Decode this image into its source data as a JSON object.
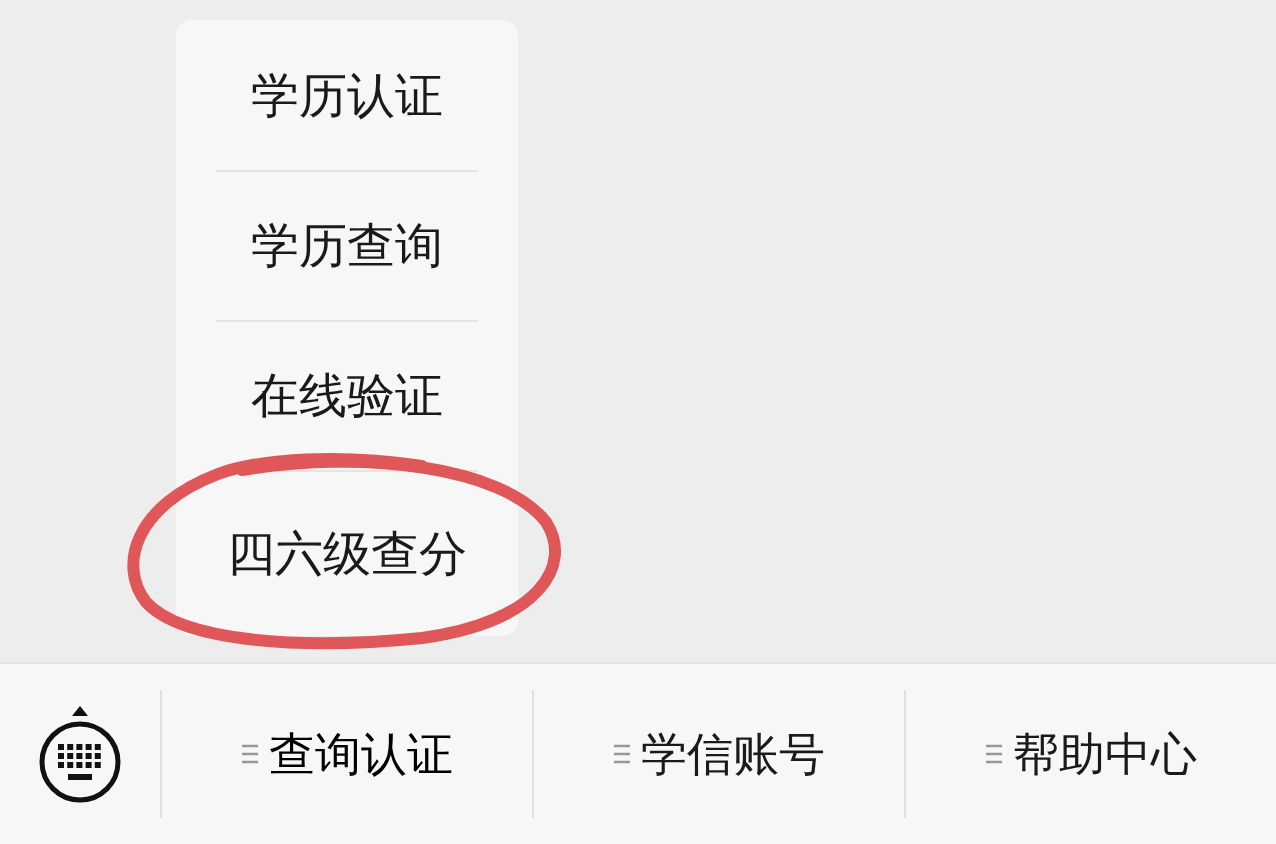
{
  "menu": {
    "items": [
      {
        "label": "学历认证",
        "circled": false
      },
      {
        "label": "学历查询",
        "circled": false
      },
      {
        "label": "在线验证",
        "circled": false
      },
      {
        "label": "四六级查分",
        "circled": true
      }
    ]
  },
  "tab_bar": {
    "tabs": [
      {
        "label": "查询认证",
        "menu_open": true
      },
      {
        "label": "学信账号",
        "menu_open": false
      },
      {
        "label": "帮助中心",
        "menu_open": false
      }
    ]
  }
}
